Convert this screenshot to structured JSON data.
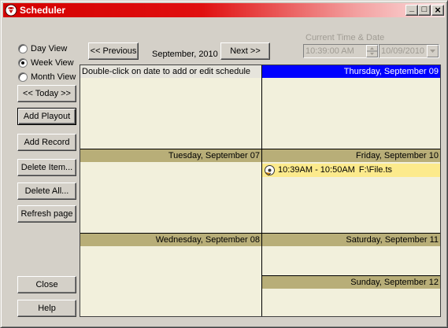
{
  "window": {
    "title": "Scheduler",
    "controls": {
      "minimize": "_",
      "maximize": "□",
      "close": "×"
    }
  },
  "view_options": [
    {
      "label": "Day View",
      "checked": false
    },
    {
      "label": "Week View",
      "checked": true
    },
    {
      "label": "Month View",
      "checked": false
    }
  ],
  "sidebar": {
    "today_label": "<< Today >>",
    "add_playout_label": "Add Playout",
    "add_record_label": "Add Record",
    "delete_item_label": "Delete Item...",
    "delete_all_label": "Delete All...",
    "refresh_label": "Refresh page",
    "close_label": "Close",
    "help_label": "Help"
  },
  "nav": {
    "previous_label": "<< Previous",
    "month_label": "September, 2010",
    "next_label": "Next >>"
  },
  "current_time": {
    "caption": "Current Time & Date",
    "time_value": "10:39:00 AM",
    "date_value": "10/09/2010"
  },
  "calendar": {
    "hint": "Double-click on date to add or edit schedule",
    "days": [
      {
        "label": "Thursday, September 09",
        "selected": true
      },
      {
        "label": "Tuesday, September 07",
        "selected": false
      },
      {
        "label": "Friday, September 10",
        "selected": false
      },
      {
        "label": "Wednesday, September 08",
        "selected": false
      },
      {
        "label": "Saturday, September 11",
        "selected": false
      },
      {
        "label": "Sunday, September 12",
        "selected": false
      }
    ],
    "events": [
      {
        "time": "10:39AM - 10:50AM",
        "file": "F:\\File.ts"
      }
    ]
  },
  "colors": {
    "title_bar": "#d40000",
    "day_header": "#b8ae78",
    "selected_day": "#0000ff",
    "calendar_bg": "#f2f0dc",
    "event_bg": "#fcea8c"
  }
}
